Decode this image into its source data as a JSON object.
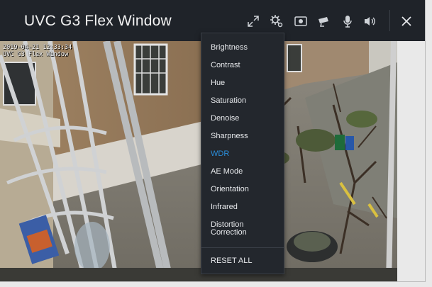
{
  "window": {
    "title": "UVC G3 Flex Window"
  },
  "toolbar": {
    "icons": [
      "expand-icon",
      "settings-icon",
      "snapshot-icon",
      "camera-icon",
      "microphone-icon",
      "speaker-icon",
      "close-icon"
    ]
  },
  "osd": {
    "timestamp": "2019-04-21 12:33:34",
    "camera_name": "UVC G3 Flex Window"
  },
  "settings_menu": {
    "items": [
      {
        "label": "Brightness"
      },
      {
        "label": "Contrast"
      },
      {
        "label": "Hue"
      },
      {
        "label": "Saturation"
      },
      {
        "label": "Denoise"
      },
      {
        "label": "Sharpness"
      },
      {
        "label": "WDR"
      },
      {
        "label": "AE Mode"
      },
      {
        "label": "Orientation"
      },
      {
        "label": "Infrared"
      },
      {
        "label": "Distortion",
        "label2": "Correction"
      }
    ],
    "active_item": "WDR",
    "active_color": "#2a8cd8",
    "reset_label": "RESET ALL"
  }
}
